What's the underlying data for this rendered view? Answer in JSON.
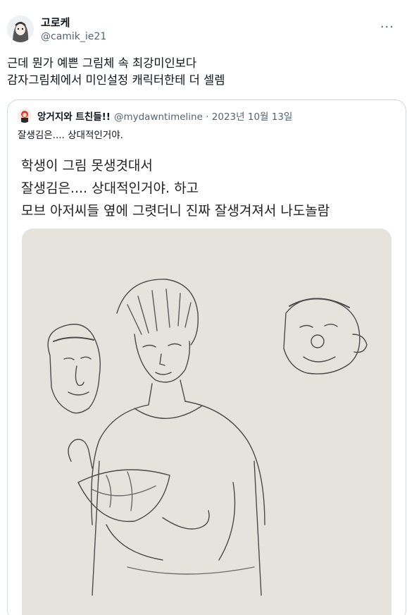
{
  "tweet": {
    "author_name": "고로케",
    "author_handle": "@camik_ie21",
    "more_label": "···",
    "text_lines": [
      "근데 뭔가 예쁜 그림체 속 최강미인보다",
      "감자그림체에서 미인설정 캐릭터한테 더 셀렘"
    ]
  },
  "quoted_tweet": {
    "author_name": "앙거지와 트친들!!",
    "author_handle": "@mydawntimeline · 2023년 10월 13일",
    "text": "잘생김은.... 상대적인거야.",
    "image_caption_lines": [
      "학생이 그림 못생겻대서",
      "잘생김은.... 상대적인거야. 하고",
      "모브 아저씨들 옆에 그렷더니 진짜 잘생겨져서 나도놀람"
    ],
    "image_alt": "pencil sketch of a young man holding a bowl, with two caricatured old men's faces beside him"
  },
  "colors": {
    "text_primary": "#0f1419",
    "text_secondary": "#536471",
    "border": "#cfd9de",
    "paper": "#e4e1da"
  },
  "icons": [
    "avatar-icon",
    "more-icon",
    "quoted-avatar-icon"
  ]
}
